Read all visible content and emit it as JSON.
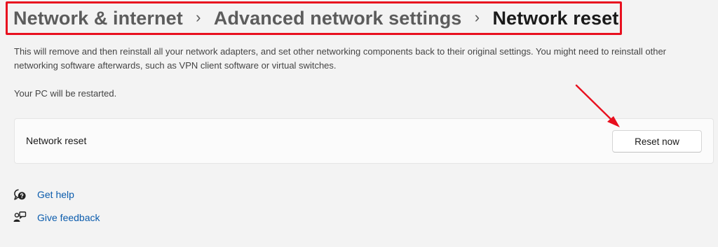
{
  "breadcrumb": {
    "items": [
      {
        "label": "Network & internet"
      },
      {
        "label": "Advanced network settings"
      },
      {
        "label": "Network reset"
      }
    ],
    "separator": "›"
  },
  "description": "This will remove and then reinstall all your network adapters, and set other networking components back to their original settings. You might need to reinstall other networking software afterwards, such as VPN client software or virtual switches.",
  "restart_note": "Your PC will be restarted.",
  "card": {
    "label": "Network reset",
    "button_label": "Reset now"
  },
  "help": {
    "get_help": "Get help",
    "give_feedback": "Give feedback"
  },
  "colors": {
    "annotation_red": "#e8101f",
    "link_blue": "#0b5cad",
    "background": "#f3f3f3"
  },
  "icons": [
    "chevron-right-icon",
    "get-help-icon",
    "feedback-icon",
    "annotation-arrow-icon"
  ]
}
